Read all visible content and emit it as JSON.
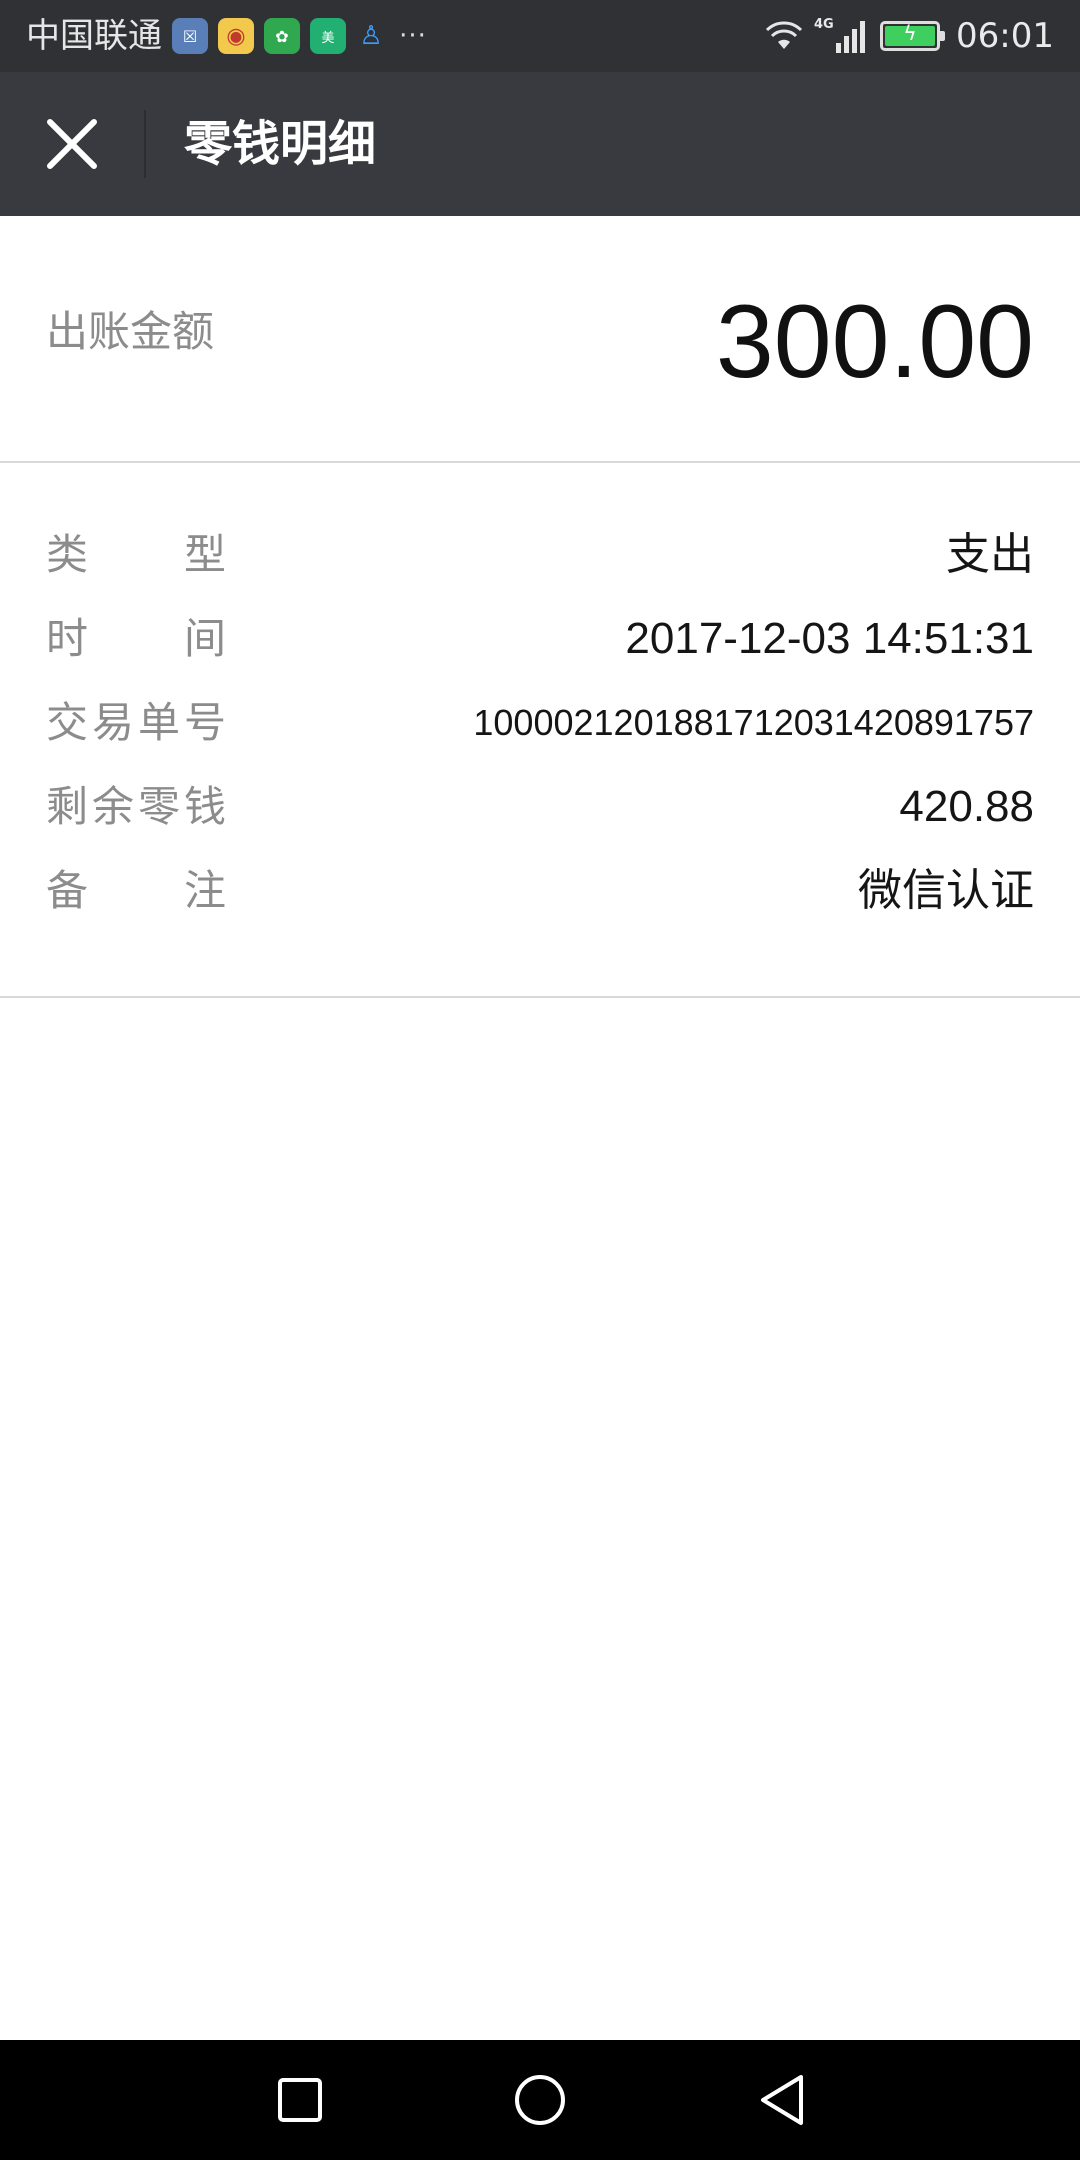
{
  "status_bar": {
    "carrier": "中国联通",
    "notification_icons": [
      "app-icon",
      "weibo-icon",
      "wechat-pay-icon",
      "meituan-icon",
      "qq-icon"
    ],
    "more": "···",
    "network": "4G",
    "time": "06:01"
  },
  "header": {
    "title": "零钱明细"
  },
  "amount": {
    "label": "出账金额",
    "value": "300.00"
  },
  "details": [
    {
      "label_chars": [
        "类",
        "型"
      ],
      "value": "支出"
    },
    {
      "label_chars": [
        "时",
        "间"
      ],
      "value": "2017-12-03 14:51:31"
    },
    {
      "label_chars": [
        "交",
        "易",
        "单",
        "号"
      ],
      "value": "100002120188171203142089​1757"
    },
    {
      "label_chars": [
        "剩",
        "余",
        "零",
        "钱"
      ],
      "value": "420.88"
    },
    {
      "label_chars": [
        "备",
        "注"
      ],
      "value": "微信认证"
    }
  ],
  "colors": {
    "status_bar": "#2f3135",
    "header": "#393a3f",
    "battery": "#3fcf5f"
  }
}
